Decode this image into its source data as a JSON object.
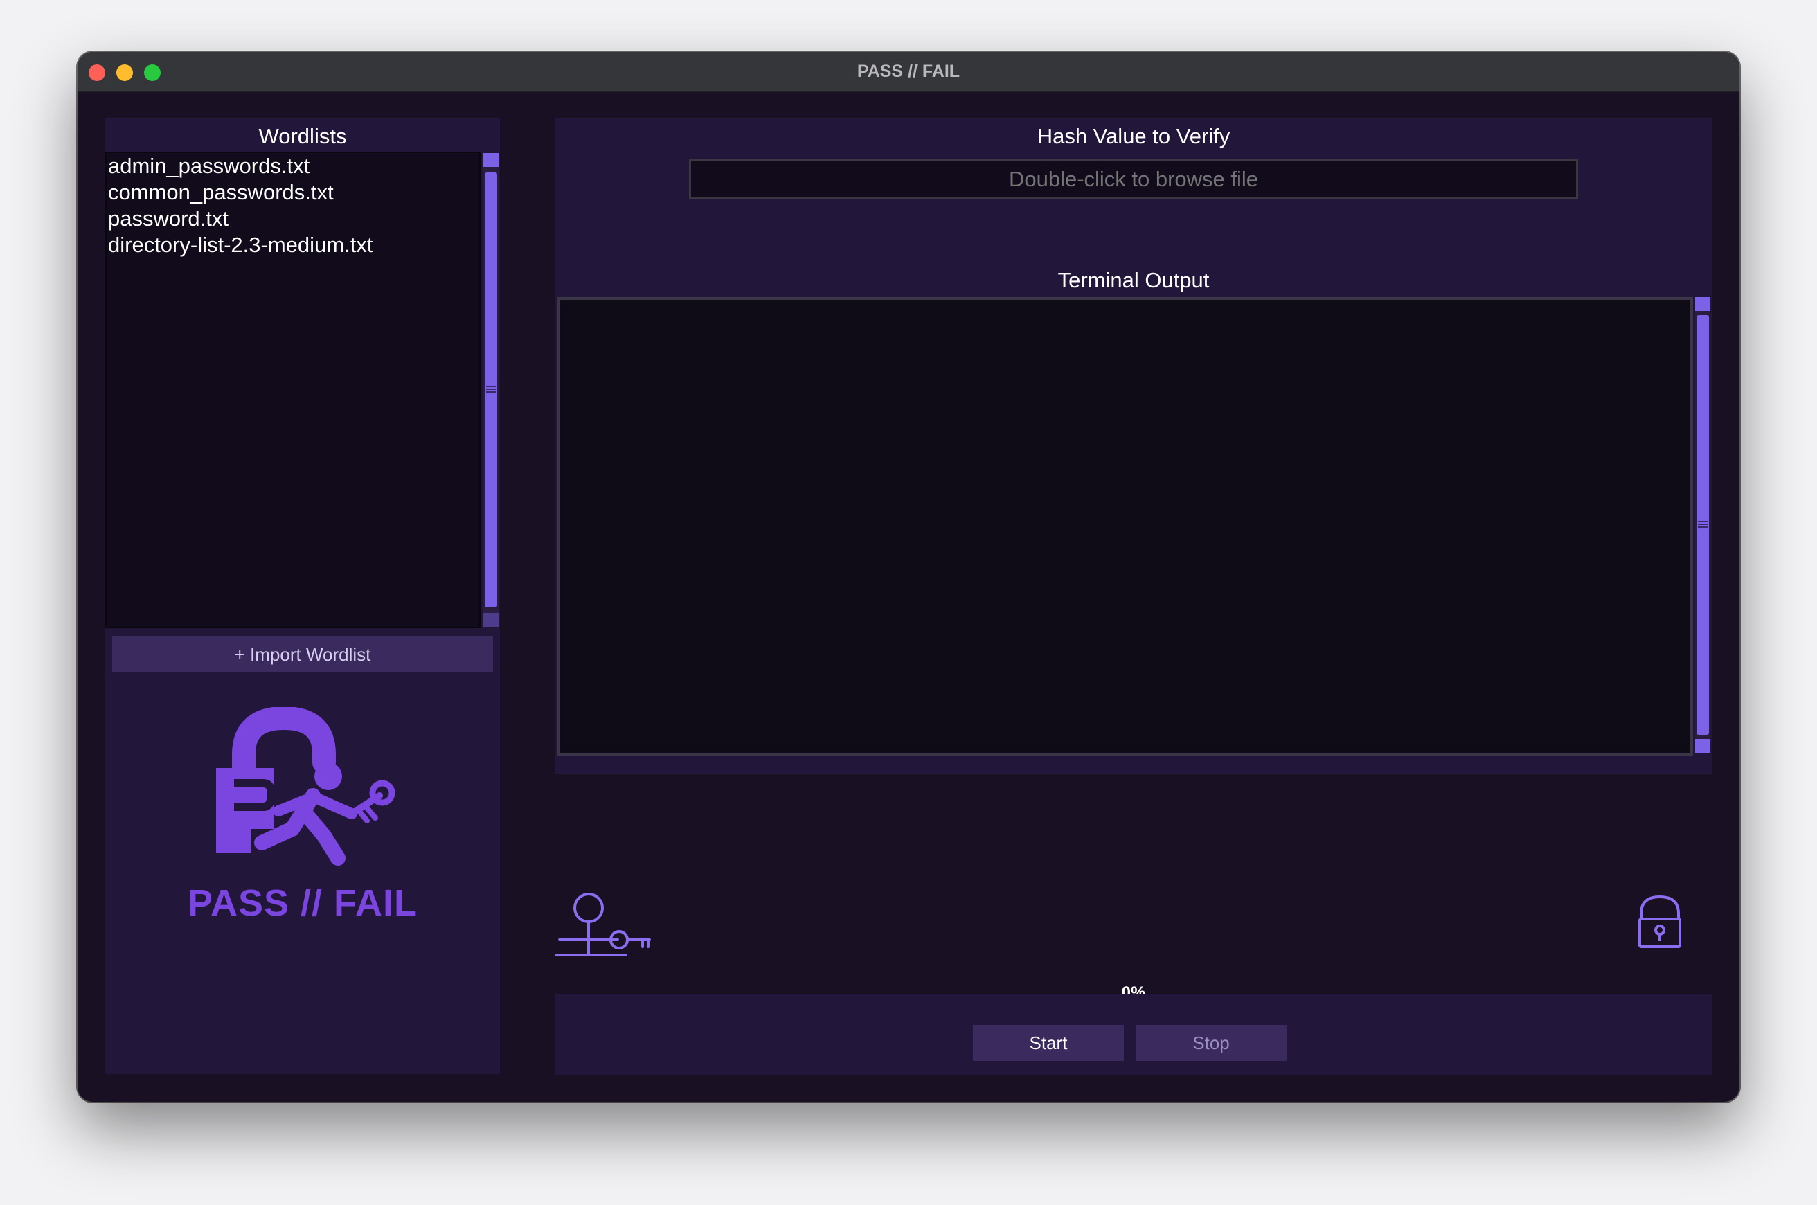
{
  "window": {
    "title": "PASS // FAIL"
  },
  "wordlists": {
    "title": "Wordlists",
    "items": [
      "admin_passwords.txt",
      "common_passwords.txt",
      "password.txt",
      "directory-list-2.3-medium.txt"
    ],
    "import_label": "+ Import Wordlist"
  },
  "logo": {
    "text": "PASS // FAIL"
  },
  "hash": {
    "title": "Hash Value to Verify",
    "placeholder": "Double-click to browse file",
    "value": ""
  },
  "terminal": {
    "title": "Terminal Output",
    "content": ""
  },
  "progress": {
    "label": "0%",
    "value": 0
  },
  "controls": {
    "start_label": "Start",
    "stop_label": "Stop"
  },
  "colors": {
    "accent": "#7c62e6",
    "logo": "#7b45e0",
    "background": "#1a1024",
    "panel": "#22173a",
    "button": "#3a2a5e"
  },
  "icons": {
    "walker_icon": "stick-figure-with-key-icon",
    "lock_icon": "padlock-icon"
  }
}
